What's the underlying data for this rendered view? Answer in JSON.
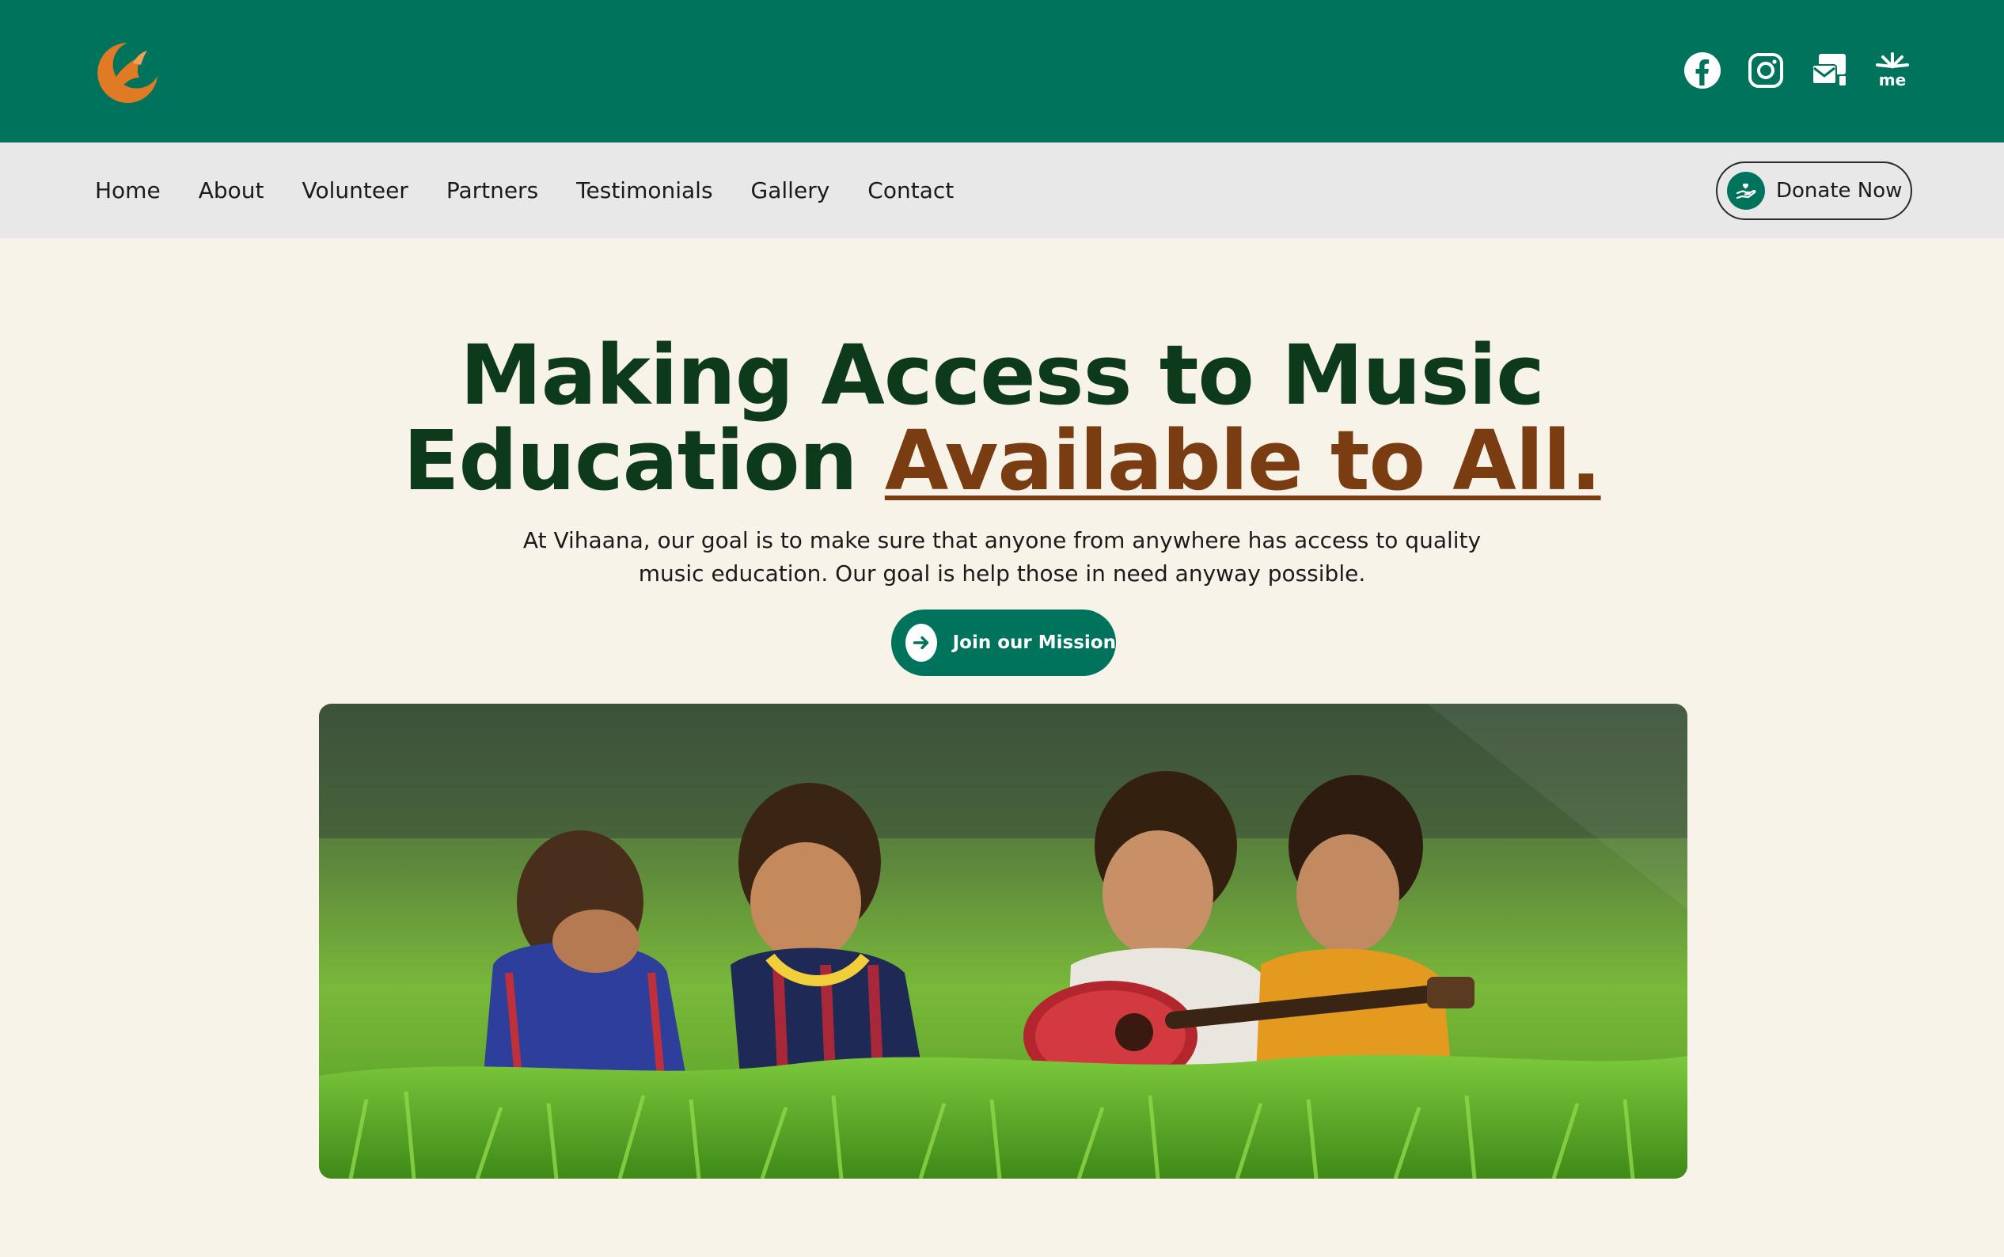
{
  "brand": {
    "logo_icon": "bird-crescent-logo-icon",
    "primary_color": "#00735d",
    "accent_color": "#7a3d12",
    "heading_color": "#0e3a1c",
    "background_color": "#f8f3e8"
  },
  "social": [
    {
      "name": "facebook-icon"
    },
    {
      "name": "instagram-icon"
    },
    {
      "name": "mail-icon"
    },
    {
      "name": "linktree-me-icon"
    }
  ],
  "nav": {
    "items": [
      {
        "label": "Home"
      },
      {
        "label": "About"
      },
      {
        "label": "Volunteer"
      },
      {
        "label": "Partners"
      },
      {
        "label": "Testimonials"
      },
      {
        "label": "Gallery"
      },
      {
        "label": "Contact"
      }
    ],
    "donate_label": "Donate Now"
  },
  "hero": {
    "title_line1": "Making Access to Music",
    "title_line2_plain": "Education ",
    "title_line2_accent": "Available to All.",
    "subtitle": "At Vihaana, our goal is to make sure that anyone from anywhere has access to quality music education. Our goal is help those in need anyway possible.",
    "cta_label": "Join our Mission",
    "image_alt": "Four children sitting in green grass, one playing a ukulele"
  }
}
